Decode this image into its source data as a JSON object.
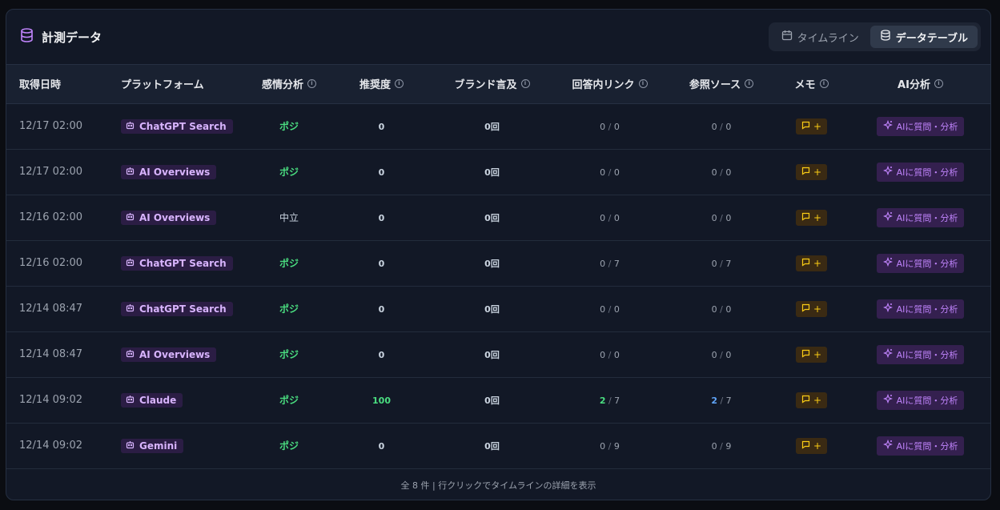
{
  "header": {
    "title": "計測データ",
    "view_toggle": [
      {
        "label": "タイムライン",
        "active": false
      },
      {
        "label": "データテーブル",
        "active": true
      }
    ]
  },
  "columns": [
    "取得日時",
    "プラットフォーム",
    "感情分析",
    "推奨度",
    "ブランド言及",
    "回答内リンク",
    "参照ソース",
    "メモ",
    "AI分析"
  ],
  "rows": [
    {
      "date": "12/17 02:00",
      "platform": "ChatGPT Search",
      "sentiment": "ポジ",
      "score": "0",
      "mentions": "0回",
      "links": "0",
      "links_total": "0",
      "sources": "0",
      "sources_total": "0"
    },
    {
      "date": "12/17 02:00",
      "platform": "AI Overviews",
      "sentiment": "ポジ",
      "score": "0",
      "mentions": "0回",
      "links": "0",
      "links_total": "0",
      "sources": "0",
      "sources_total": "0"
    },
    {
      "date": "12/16 02:00",
      "platform": "AI Overviews",
      "sentiment": "中立",
      "score": "0",
      "mentions": "0回",
      "links": "0",
      "links_total": "0",
      "sources": "0",
      "sources_total": "0"
    },
    {
      "date": "12/16 02:00",
      "platform": "ChatGPT Search",
      "sentiment": "ポジ",
      "score": "0",
      "mentions": "0回",
      "links": "0",
      "links_total": "7",
      "sources": "0",
      "sources_total": "7"
    },
    {
      "date": "12/14 08:47",
      "platform": "ChatGPT Search",
      "sentiment": "ポジ",
      "score": "0",
      "mentions": "0回",
      "links": "0",
      "links_total": "0",
      "sources": "0",
      "sources_total": "0"
    },
    {
      "date": "12/14 08:47",
      "platform": "AI Overviews",
      "sentiment": "ポジ",
      "score": "0",
      "mentions": "0回",
      "links": "0",
      "links_total": "0",
      "sources": "0",
      "sources_total": "0"
    },
    {
      "date": "12/14 09:02",
      "platform": "Claude",
      "sentiment": "ポジ",
      "score": "100",
      "mentions": "0回",
      "links": "2",
      "links_total": "7",
      "sources": "2",
      "sources_total": "7"
    },
    {
      "date": "12/14 09:02",
      "platform": "Gemini",
      "sentiment": "ポジ",
      "score": "0",
      "mentions": "0回",
      "links": "0",
      "links_total": "9",
      "sources": "0",
      "sources_total": "9"
    }
  ],
  "actions": {
    "memo_label": "+",
    "ai_label": "AIに質問・分析"
  },
  "footer": "全 8 件 | 行クリックでタイムラインの詳細を表示",
  "colors": {
    "positive": "#4ade80",
    "link_highlight": "#60a5fa",
    "platform_badge": "#d8b4fe",
    "memo": "#facc15",
    "ai": "#c084fc"
  }
}
